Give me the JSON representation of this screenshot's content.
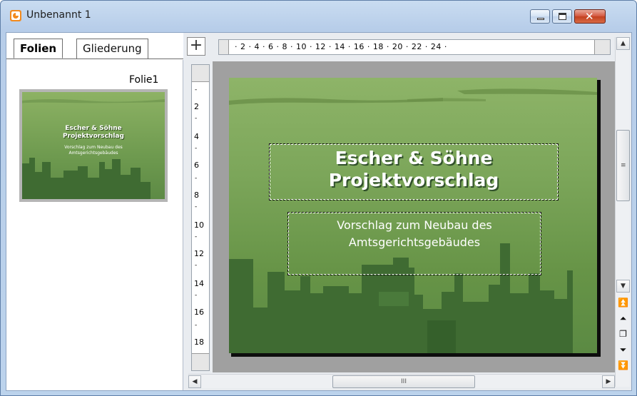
{
  "window": {
    "title": "Unbenannt 1",
    "controls": {
      "minimize": "minimize",
      "maximize": "maximize",
      "close": "✕"
    }
  },
  "slide_pane": {
    "tabs": [
      {
        "label": "Folien",
        "active": true
      },
      {
        "label": "Gliederung",
        "active": false
      }
    ],
    "slide_label": "Folie1",
    "thumbnail": {
      "title_line1": "Escher & Söhne",
      "title_line2": "Projektvorschlag",
      "subtitle_line1": "Vorschlag zum Neubau des",
      "subtitle_line2": "Amtsgerichtsgebäudes"
    }
  },
  "rulers": {
    "horizontal": "· 2 · 4 · 6 · 8 · 10 · 12 · 14 · 16 · 18 · 20 · 22 · 24 ·",
    "vertical": [
      "2",
      "4",
      "6",
      "8",
      "10",
      "12",
      "14",
      "16",
      "18"
    ]
  },
  "slide": {
    "title_line1": "Escher & Söhne",
    "title_line2": "Projektvorschlag",
    "subtitle_line1": "Vorschlag zum Neubau des",
    "subtitle_line2": "Amtsgerichtsgebäudes"
  },
  "scrollbars": {
    "hthumb_grip": "III",
    "vthumb_grip": "≡"
  },
  "colors": {
    "slide_top": "#8eb468",
    "slide_bottom": "#5b8a43",
    "skyline": "#3f6b32",
    "close_button": "#c3401f"
  }
}
